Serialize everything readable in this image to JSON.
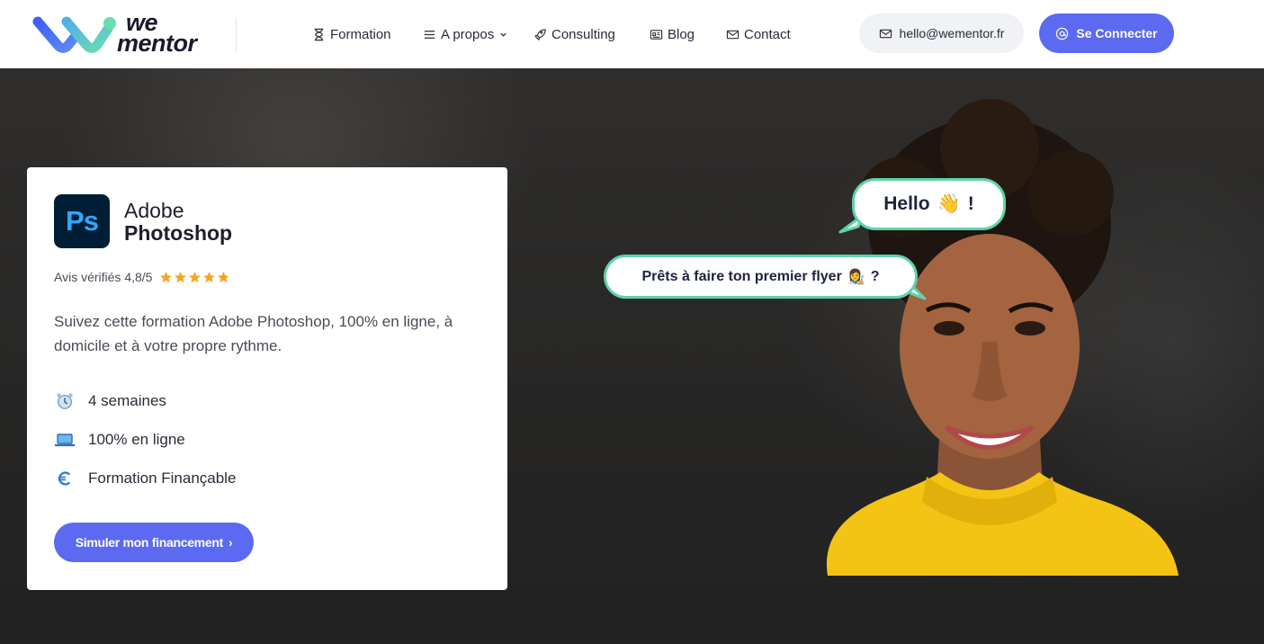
{
  "brand": {
    "line1": "we",
    "line2": "mentor"
  },
  "nav": {
    "formation": "Formation",
    "apropos": "A propos",
    "consulting": "Consulting",
    "blog": "Blog",
    "contact": "Contact"
  },
  "header": {
    "email": "hello@wementor.fr",
    "connect_label": "Se Connecter"
  },
  "card": {
    "logo_text": "Ps",
    "product_line1": "Adobe",
    "product_line2": "Photoshop",
    "rating_text": "Avis vérifiés 4,8/5",
    "rating_value": 4.8,
    "rating_max": 5,
    "description": "Suivez cette formation Adobe Photoshop, 100% en ligne, à domicile et à votre propre rythme.",
    "features": [
      {
        "icon": "alarm-clock-icon",
        "label": "4 semaines"
      },
      {
        "icon": "laptop-icon",
        "label": "100% en ligne"
      },
      {
        "icon": "euro-icon",
        "label": "Formation Finançable"
      }
    ],
    "cta_label": "Simuler mon financement",
    "cta_chevron": "›"
  },
  "bubbles": {
    "hello_text": "Hello",
    "hello_emoji": "👋",
    "hello_suffix": "!",
    "flyer_text": "Prêts à faire ton premier flyer",
    "flyer_emoji": "👩‍🎨",
    "flyer_suffix": "?"
  },
  "colors": {
    "accent": "#5b6af0",
    "bubble_border": "#5fd3a8",
    "photoshop_bg": "#001e36",
    "photoshop_text": "#31a8ff",
    "star": "#f5a623",
    "sweater": "#f4c414"
  }
}
